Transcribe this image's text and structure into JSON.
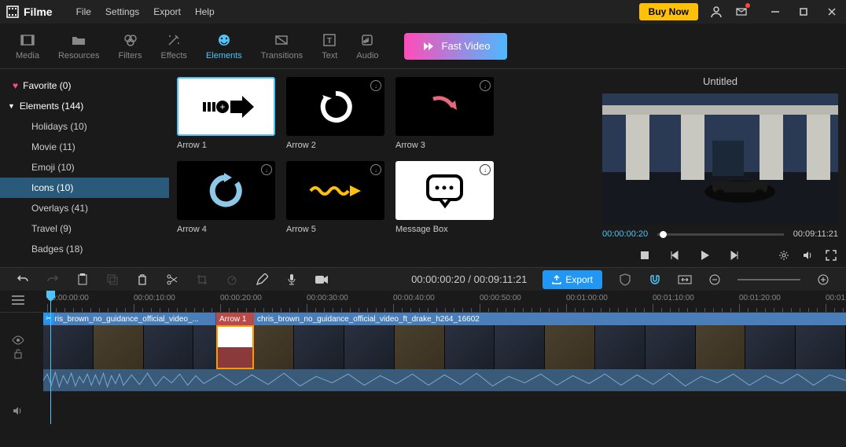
{
  "app": {
    "name": "Filme"
  },
  "menu": {
    "file": "File",
    "settings": "Settings",
    "export": "Export",
    "help": "Help"
  },
  "titlebar": {
    "buy": "Buy Now"
  },
  "toolbar": {
    "media": "Media",
    "resources": "Resources",
    "filters": "Filters",
    "effects": "Effects",
    "elements": "Elements",
    "transitions": "Transitions",
    "text": "Text",
    "audio": "Audio",
    "fast_video": "Fast Video"
  },
  "sidebar": {
    "favorite": "Favorite (0)",
    "elements": "Elements (144)",
    "subs": [
      "Holidays (10)",
      "Movie (11)",
      "Emoji (10)",
      "Icons (10)",
      "Overlays (41)",
      "Travel (9)",
      "Badges (18)"
    ]
  },
  "grid": {
    "items": [
      {
        "label": "Arrow 1"
      },
      {
        "label": "Arrow 2"
      },
      {
        "label": "Arrow 3"
      },
      {
        "label": "Arrow 4"
      },
      {
        "label": "Arrow 5"
      },
      {
        "label": "Message Box"
      }
    ]
  },
  "preview": {
    "title": "Untitled",
    "current": "00:00:00:20",
    "total": "00:09:11:21"
  },
  "editbar": {
    "time": "00:00:00:20 / 00:09:11:21",
    "export": "Export"
  },
  "ruler": [
    "00:00:00:00",
    "00:00:10:00",
    "00:00:20:00",
    "00:00:30:00",
    "00:00:40:00",
    "00:00:50:00",
    "00:01:00:00",
    "00:01:10:00",
    "00:01:20:00",
    "00:01"
  ],
  "clips": {
    "cut": "chris_brown_no_guidance_official_video_...",
    "arrow": "Arrow 1",
    "rest": "chris_brown_no_guidance_official_video_ft_drake_h264_16602"
  }
}
